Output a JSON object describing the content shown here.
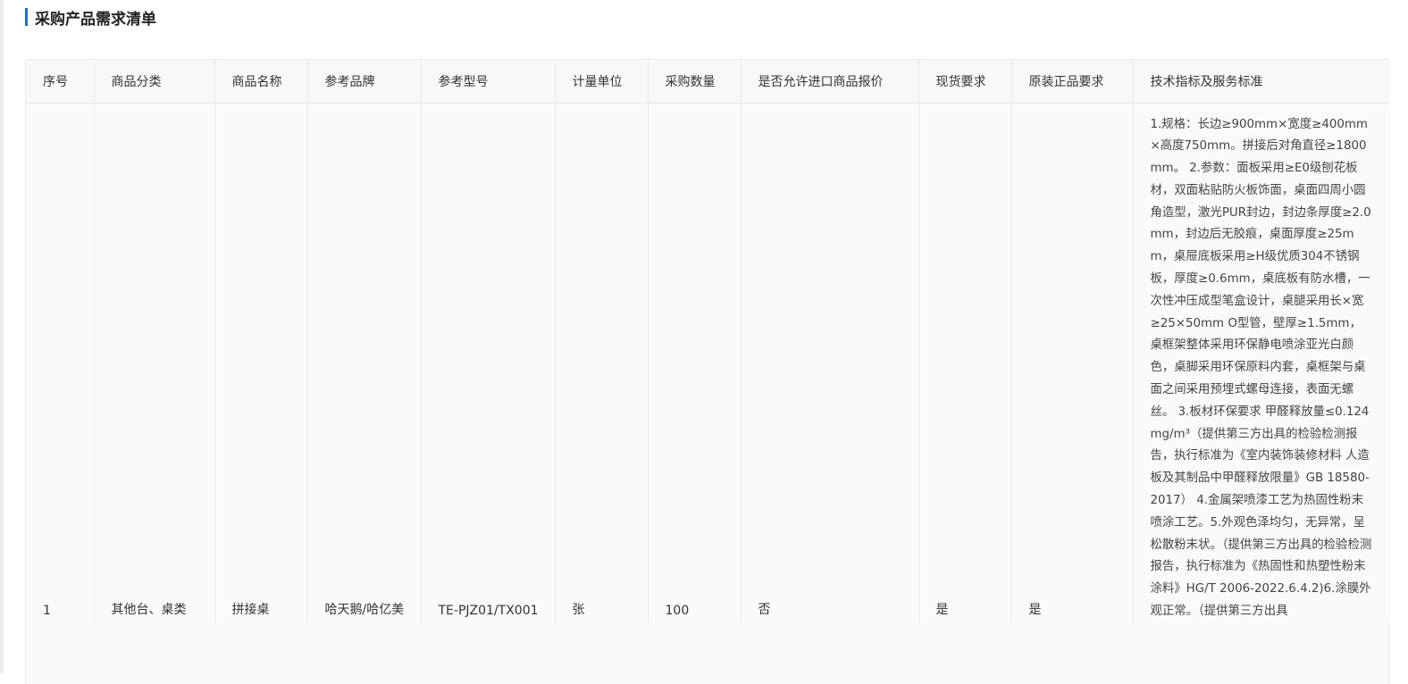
{
  "section": {
    "title": "采购产品需求清单"
  },
  "table": {
    "headers": [
      "序号",
      "商品分类",
      "商品名称",
      "参考品牌",
      "参考型号",
      "计量单位",
      "采购数量",
      "是否允许进口商品报价",
      "现货要求",
      "原装正品要求",
      "技术指标及服务标准"
    ],
    "rows": [
      {
        "index": "1",
        "category": "其他台、桌类",
        "name": "拼接桌",
        "brand": "哈天鹅/哈亿美",
        "model": "TE-PJZ01/TX001",
        "unit": "张",
        "quantity": "100",
        "import_allowed": "否",
        "in_stock": "是",
        "genuine": "是",
        "spec": "1.规格：长边≥900mm×宽度≥400mm×高度750mm。拼接后对角直径≥1800mm。 2.参数：面板采用≥E0级刨花板材，双面粘贴防火板饰面，桌面四周小圆角造型，激光PUR封边，封边条厚度≥2.0mm，封边后无胶痕，桌面厚度≥25mm，桌屉底板采用≥H级优质304不锈钢板，厚度≥0.6mm，桌底板有防水槽，一次性冲压成型笔盒设计，桌腿采用长×宽≥25×50mm O型管，壁厚≥1.5mm，桌框架整体采用环保静电喷涂亚光白颜色，桌脚采用环保原料内套，桌框架与桌面之间采用预埋式螺母连接，表面无螺丝。 3.板材环保要求 甲醛释放量≤0.124mg/m³（提供第三方出具的检验检测报告，执行标准为《室内装饰装修材料 人造板及其制品中甲醛释放限量》GB 18580-2017） 4.金属架喷漆工艺为热固性粉末喷涂工艺。5.外观色泽均匀，无异常，呈松散粉末状。（提供第三方出具的检验检测报告，执行标准为《热固性和热塑性粉末涂料》HG/T 2006-2022.6.4.2)6.涂膜外观正常。（提供第三方出具"
      }
    ]
  },
  "colors": {
    "accent": "#1a6fd6",
    "border": "#e8e8e8",
    "header_bg": "#f8f8f8"
  }
}
